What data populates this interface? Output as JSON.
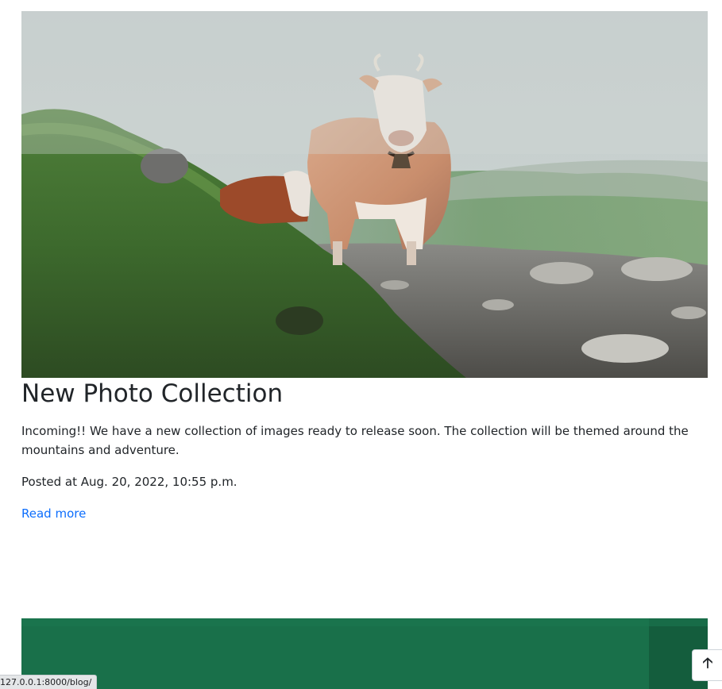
{
  "posts": [
    {
      "image_alt": "Cows standing on a foggy alpine hillside",
      "title": "New Photo Collection",
      "excerpt": "Incoming!! We have a new collection of images ready to release soon. The collection will be themed around the mountains and adventure.",
      "meta": "Posted at Aug. 20, 2022, 10:55 p.m.",
      "read_more": "Read more"
    }
  ],
  "status_bar": {
    "url": "127.0.0.1:8000/blog/"
  },
  "back_to_top": {
    "icon": "arrow-up-icon",
    "glyph": "🡡"
  },
  "colors": {
    "link": "#0d6efd",
    "text": "#212529",
    "second_image_green": "#19704a"
  }
}
